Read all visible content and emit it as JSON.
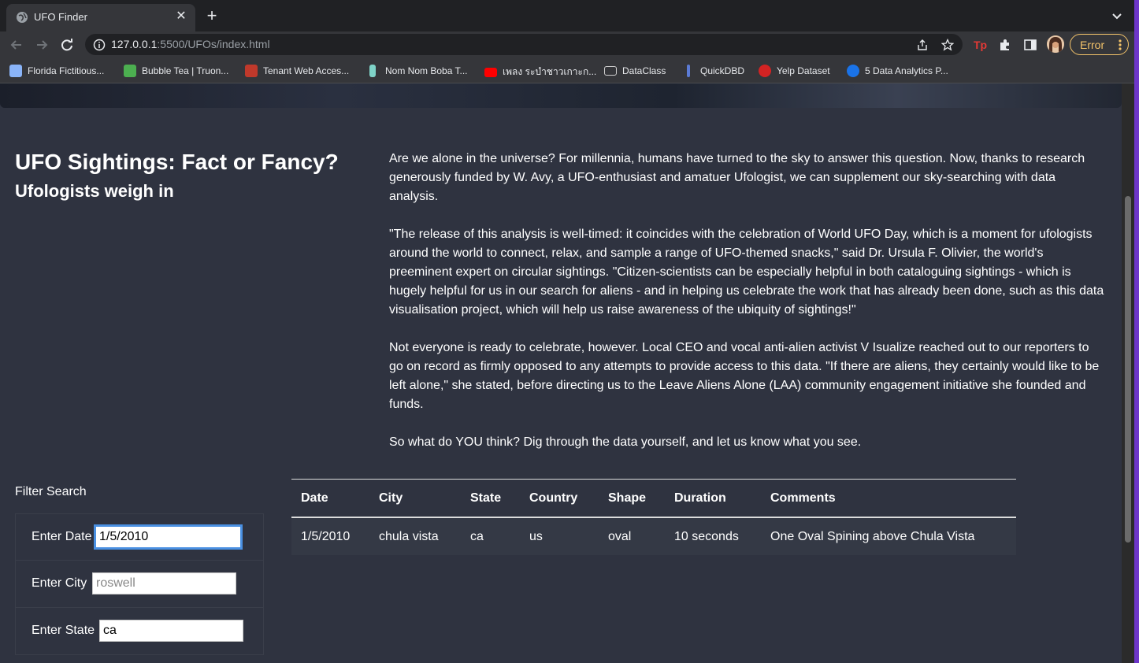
{
  "browser": {
    "tab_title": "UFO Finder",
    "url_host": "127.0.0.1",
    "url_path": ":5500/UFOs/index.html",
    "error_label": "Error",
    "bookmarks": [
      {
        "label": "Florida Fictitious...",
        "icon": "document-icon",
        "color": "#8ab4f8"
      },
      {
        "label": "Bubble Tea | Truon...",
        "icon": "leaf-icon",
        "color": "#4caf50"
      },
      {
        "label": "Tenant Web Acces...",
        "icon": "building-icon",
        "color": "#c0392b"
      },
      {
        "label": "Nom Nom Boba T...",
        "icon": "boba-icon",
        "color": "#7fd3c8"
      },
      {
        "label": "เพลง ระบำชาวเกาะก...",
        "icon": "youtube-icon",
        "color": "#ff0000"
      },
      {
        "label": "DataClass",
        "icon": "folder-icon",
        "color": "#cfcfcf"
      },
      {
        "label": "QuickDBD",
        "icon": "pen-icon",
        "color": "#5b7bd5"
      },
      {
        "label": "Yelp Dataset",
        "icon": "yelp-icon",
        "color": "#d32323"
      },
      {
        "label": "5 Data Analytics P...",
        "icon": "c-logo-icon",
        "color": "#1a73e8"
      }
    ]
  },
  "header": {
    "title": "UFO Sightings: Fact or Fancy?",
    "subtitle": "Ufologists weigh in"
  },
  "article": {
    "paragraphs": [
      "Are we alone in the universe? For millennia, humans have turned to the sky to answer this question. Now, thanks to research generously funded by W. Avy, a UFO-enthusiast and amatuer Ufologist, we can supplement our sky-searching with data analysis.",
      "\"The release of this analysis is well-timed: it coincides with the celebration of World UFO Day, which is a moment for ufologists around the world to connect, relax, and sample a range of UFO-themed snacks,\" said Dr. Ursula F. Olivier, the world's preeminent expert on circular sightings. \"Citizen-scientists can be especially helpful in both cataloguing sightings - which is hugely helpful for us in our search for aliens - and in helping us celebrate the work that has already been done, such as this data visualisation project, which will help us raise awareness of the ubiquity of sightings!\"",
      "Not everyone is ready to celebrate, however. Local CEO and vocal anti-alien activist V Isualize reached out to our reporters to go on record as firmly opposed to any attempts to provide access to this data. \"If there are aliens, they certainly would like to be left alone,\" she stated, before directing us to the Leave Aliens Alone (LAA) community engagement initiative she founded and funds.",
      "So what do YOU think? Dig through the data yourself, and let us know what you see."
    ]
  },
  "filters": {
    "heading": "Filter Search",
    "date": {
      "label": "Enter Date",
      "value": "1/5/2010",
      "placeholder": ""
    },
    "city": {
      "label": "Enter City",
      "value": "",
      "placeholder": "roswell"
    },
    "state": {
      "label": "Enter State",
      "value": "ca",
      "placeholder": ""
    }
  },
  "table": {
    "columns": [
      "Date",
      "City",
      "State",
      "Country",
      "Shape",
      "Duration",
      "Comments"
    ],
    "rows": [
      [
        "1/5/2010",
        "chula vista",
        "ca",
        "us",
        "oval",
        "10 seconds",
        "One Oval Spining above Chula Vista"
      ]
    ]
  }
}
